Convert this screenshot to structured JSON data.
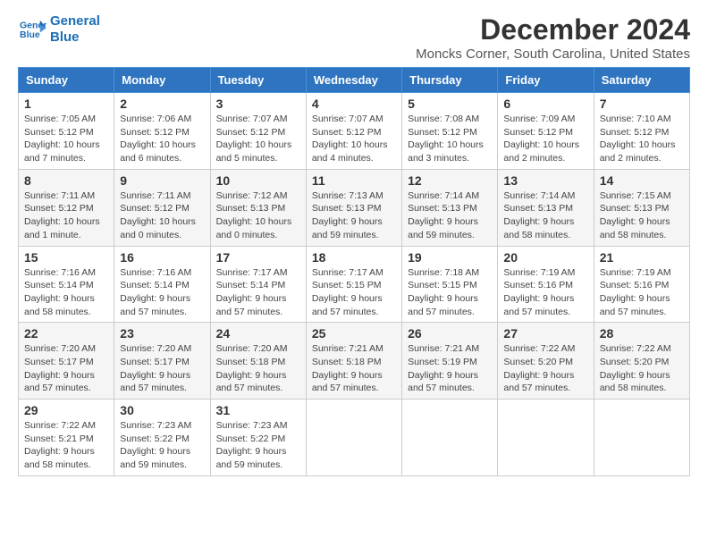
{
  "logo": {
    "line1": "General",
    "line2": "Blue"
  },
  "title": "December 2024",
  "location": "Moncks Corner, South Carolina, United States",
  "headers": [
    "Sunday",
    "Monday",
    "Tuesday",
    "Wednesday",
    "Thursday",
    "Friday",
    "Saturday"
  ],
  "weeks": [
    [
      {
        "day": "1",
        "sunrise": "7:05 AM",
        "sunset": "5:12 PM",
        "daylight": "10 hours and 7 minutes."
      },
      {
        "day": "2",
        "sunrise": "7:06 AM",
        "sunset": "5:12 PM",
        "daylight": "10 hours and 6 minutes."
      },
      {
        "day": "3",
        "sunrise": "7:07 AM",
        "sunset": "5:12 PM",
        "daylight": "10 hours and 5 minutes."
      },
      {
        "day": "4",
        "sunrise": "7:07 AM",
        "sunset": "5:12 PM",
        "daylight": "10 hours and 4 minutes."
      },
      {
        "day": "5",
        "sunrise": "7:08 AM",
        "sunset": "5:12 PM",
        "daylight": "10 hours and 3 minutes."
      },
      {
        "day": "6",
        "sunrise": "7:09 AM",
        "sunset": "5:12 PM",
        "daylight": "10 hours and 2 minutes."
      },
      {
        "day": "7",
        "sunrise": "7:10 AM",
        "sunset": "5:12 PM",
        "daylight": "10 hours and 2 minutes."
      }
    ],
    [
      {
        "day": "8",
        "sunrise": "7:11 AM",
        "sunset": "5:12 PM",
        "daylight": "10 hours and 1 minute."
      },
      {
        "day": "9",
        "sunrise": "7:11 AM",
        "sunset": "5:12 PM",
        "daylight": "10 hours and 0 minutes."
      },
      {
        "day": "10",
        "sunrise": "7:12 AM",
        "sunset": "5:13 PM",
        "daylight": "10 hours and 0 minutes."
      },
      {
        "day": "11",
        "sunrise": "7:13 AM",
        "sunset": "5:13 PM",
        "daylight": "9 hours and 59 minutes."
      },
      {
        "day": "12",
        "sunrise": "7:14 AM",
        "sunset": "5:13 PM",
        "daylight": "9 hours and 59 minutes."
      },
      {
        "day": "13",
        "sunrise": "7:14 AM",
        "sunset": "5:13 PM",
        "daylight": "9 hours and 58 minutes."
      },
      {
        "day": "14",
        "sunrise": "7:15 AM",
        "sunset": "5:13 PM",
        "daylight": "9 hours and 58 minutes."
      }
    ],
    [
      {
        "day": "15",
        "sunrise": "7:16 AM",
        "sunset": "5:14 PM",
        "daylight": "9 hours and 58 minutes."
      },
      {
        "day": "16",
        "sunrise": "7:16 AM",
        "sunset": "5:14 PM",
        "daylight": "9 hours and 57 minutes."
      },
      {
        "day": "17",
        "sunrise": "7:17 AM",
        "sunset": "5:14 PM",
        "daylight": "9 hours and 57 minutes."
      },
      {
        "day": "18",
        "sunrise": "7:17 AM",
        "sunset": "5:15 PM",
        "daylight": "9 hours and 57 minutes."
      },
      {
        "day": "19",
        "sunrise": "7:18 AM",
        "sunset": "5:15 PM",
        "daylight": "9 hours and 57 minutes."
      },
      {
        "day": "20",
        "sunrise": "7:19 AM",
        "sunset": "5:16 PM",
        "daylight": "9 hours and 57 minutes."
      },
      {
        "day": "21",
        "sunrise": "7:19 AM",
        "sunset": "5:16 PM",
        "daylight": "9 hours and 57 minutes."
      }
    ],
    [
      {
        "day": "22",
        "sunrise": "7:20 AM",
        "sunset": "5:17 PM",
        "daylight": "9 hours and 57 minutes."
      },
      {
        "day": "23",
        "sunrise": "7:20 AM",
        "sunset": "5:17 PM",
        "daylight": "9 hours and 57 minutes."
      },
      {
        "day": "24",
        "sunrise": "7:20 AM",
        "sunset": "5:18 PM",
        "daylight": "9 hours and 57 minutes."
      },
      {
        "day": "25",
        "sunrise": "7:21 AM",
        "sunset": "5:18 PM",
        "daylight": "9 hours and 57 minutes."
      },
      {
        "day": "26",
        "sunrise": "7:21 AM",
        "sunset": "5:19 PM",
        "daylight": "9 hours and 57 minutes."
      },
      {
        "day": "27",
        "sunrise": "7:22 AM",
        "sunset": "5:20 PM",
        "daylight": "9 hours and 57 minutes."
      },
      {
        "day": "28",
        "sunrise": "7:22 AM",
        "sunset": "5:20 PM",
        "daylight": "9 hours and 58 minutes."
      }
    ],
    [
      {
        "day": "29",
        "sunrise": "7:22 AM",
        "sunset": "5:21 PM",
        "daylight": "9 hours and 58 minutes."
      },
      {
        "day": "30",
        "sunrise": "7:23 AM",
        "sunset": "5:22 PM",
        "daylight": "9 hours and 59 minutes."
      },
      {
        "day": "31",
        "sunrise": "7:23 AM",
        "sunset": "5:22 PM",
        "daylight": "9 hours and 59 minutes."
      },
      null,
      null,
      null,
      null
    ]
  ],
  "labels": {
    "sunrise": "Sunrise:",
    "sunset": "Sunset:",
    "daylight": "Daylight:"
  }
}
